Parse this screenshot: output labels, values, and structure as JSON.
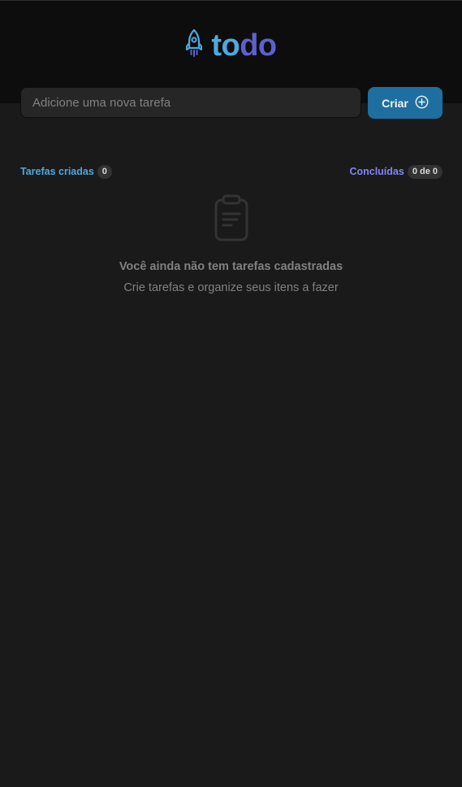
{
  "header": {
    "logo_icon": "rocket-icon",
    "logo_part_1": "to",
    "logo_part_2": "do",
    "colors": {
      "to": "#4ea8de",
      "do": "#5e60ce"
    }
  },
  "form": {
    "input_placeholder": "Adicione uma nova tarefa",
    "input_value": "",
    "create_label": "Criar",
    "create_icon": "plus-circle-icon",
    "button_color": "#1e6f9f"
  },
  "counters": {
    "created_label": "Tarefas criadas",
    "created_count": "0",
    "done_label": "Concluídas",
    "done_count": "0 de 0"
  },
  "empty_state": {
    "icon": "clipboard-icon",
    "title": "Você ainda não tem tarefas cadastradas",
    "subtitle": "Crie tarefas e organize seus itens a fazer"
  }
}
